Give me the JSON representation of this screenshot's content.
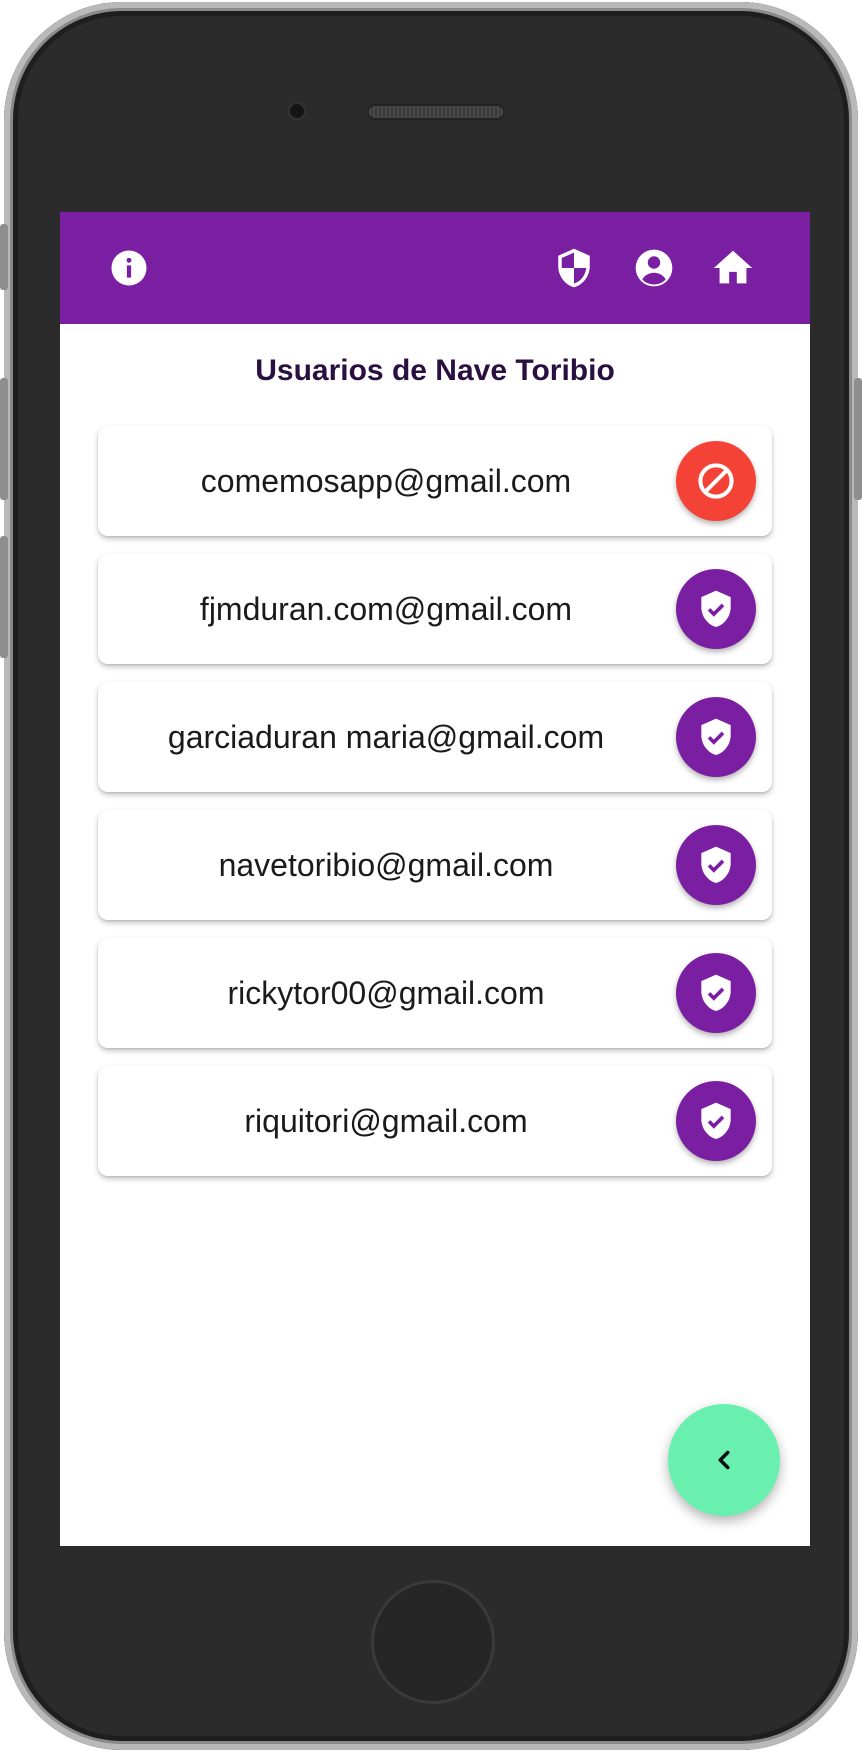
{
  "theme": {
    "appbar_color": "#7b1fa2",
    "block_color": "#f44336",
    "approve_color": "#7b1fa2",
    "fab_color": "#69f0ae"
  },
  "appbar": {
    "left_icons": [
      "info-icon"
    ],
    "right_icons": [
      "shield-icon",
      "account-circle-icon",
      "home-icon"
    ]
  },
  "page": {
    "title": "Usuarios de Nave Toribio"
  },
  "users": [
    {
      "email": "comemosapp@gmail.com",
      "action_icon": "block-icon"
    },
    {
      "email": "fjmduran.com@gmail.com",
      "action_icon": "verified-shield-icon"
    },
    {
      "email": "garciaduran maria@gmail.com",
      "action_icon": "verified-shield-icon"
    },
    {
      "email": "navetoribio@gmail.com",
      "action_icon": "verified-shield-icon"
    },
    {
      "email": "rickytor00@gmail.com",
      "action_icon": "verified-shield-icon"
    },
    {
      "email": "riquitori@gmail.com",
      "action_icon": "verified-shield-icon"
    }
  ],
  "fab": {
    "icon": "chevron-left-icon"
  }
}
